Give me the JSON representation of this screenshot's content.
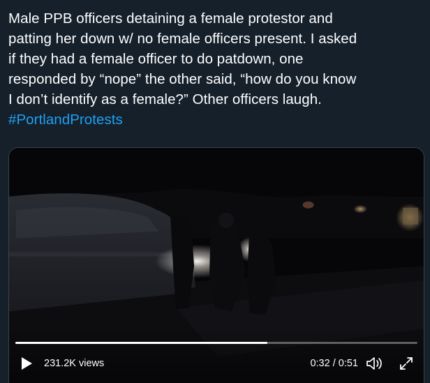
{
  "tweet": {
    "lines": [
      "Male PPB officers detaining a female protestor and",
      "patting her down w/ no female officers present. I asked",
      "if they had a female officer to do patdown, one",
      "responded by “nope” the other said, “how do you know",
      "I don’t identify as a female?” Other officers laugh."
    ],
    "hashtag": "#PortlandProtests"
  },
  "video": {
    "views": "231.2K views",
    "time": "0:32 / 0:51",
    "progress_fraction": 0.627,
    "icons": {
      "play": "play-icon",
      "volume": "volume-icon",
      "fullscreen": "fullscreen-icon"
    }
  },
  "colors": {
    "background": "#15202b",
    "text": "#ffffff",
    "hashtag": "#1da1f2",
    "progress_fill": "#ffffff"
  }
}
